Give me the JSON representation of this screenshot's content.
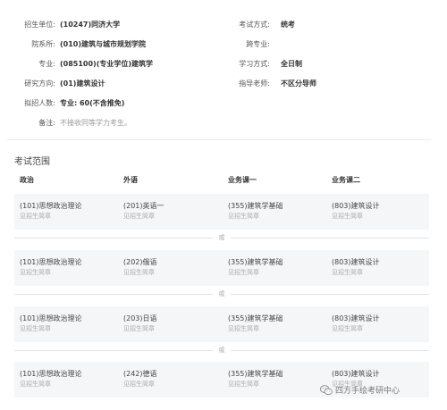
{
  "info": {
    "unit_label": "招生单位:",
    "unit_value": "(10247)同济大学",
    "exam_method_label": "考试方式:",
    "exam_method_value": "统考",
    "dept_label": "院系所:",
    "dept_value": "(010)建筑与城市规划学院",
    "cross_major_label": "跨专业:",
    "cross_major_value": "",
    "major_label": "专业:",
    "major_value": "(085100)(专业学位)建筑学",
    "study_mode_label": "学习方式:",
    "study_mode_value": "全日制",
    "direction_label": "研究方向:",
    "direction_value": "(01)建筑设计",
    "advisor_label": "指导老师:",
    "advisor_value": "不区分导师",
    "quota_label": "拟招人数:",
    "quota_value": "专业: 60(不含推免)",
    "remark_label": "备注:",
    "remark_value": "不接收同等学力考生。"
  },
  "exam_scope": {
    "title": "考试范围",
    "headers": [
      "政治",
      "外语",
      "业务课一",
      "业务课二"
    ],
    "or_text": "或",
    "rows": [
      [
        {
          "name": "(101)思想政治理论",
          "sub": "见招生简章"
        },
        {
          "name": "(201)英语一",
          "sub": "见招生简章"
        },
        {
          "name": "(355)建筑学基础",
          "sub": "见招生简章"
        },
        {
          "name": "(803)建筑设计",
          "sub": "见招生简章"
        }
      ],
      [
        {
          "name": "(101)思想政治理论",
          "sub": "见招生简章"
        },
        {
          "name": "(202)俄语",
          "sub": "见招生简章"
        },
        {
          "name": "(355)建筑学基础",
          "sub": "见招生简章"
        },
        {
          "name": "(803)建筑设计",
          "sub": "见招生简章"
        }
      ],
      [
        {
          "name": "(101)思想政治理论",
          "sub": "见招生简章"
        },
        {
          "name": "(203)日语",
          "sub": "见招生简章"
        },
        {
          "name": "(355)建筑学基础",
          "sub": "见招生简章"
        },
        {
          "name": "(803)建筑设计",
          "sub": "见招生简章"
        }
      ],
      [
        {
          "name": "(101)思想政治理论",
          "sub": "见招生简章"
        },
        {
          "name": "(242)德语",
          "sub": "见招生简章"
        },
        {
          "name": "(355)建筑学基础",
          "sub": "见招生简章"
        },
        {
          "name": "(803)建筑设计",
          "sub": "见招生简章"
        }
      ]
    ]
  },
  "watermark": {
    "icon": "wechat-icon",
    "text": "四方手绘考研中心"
  }
}
